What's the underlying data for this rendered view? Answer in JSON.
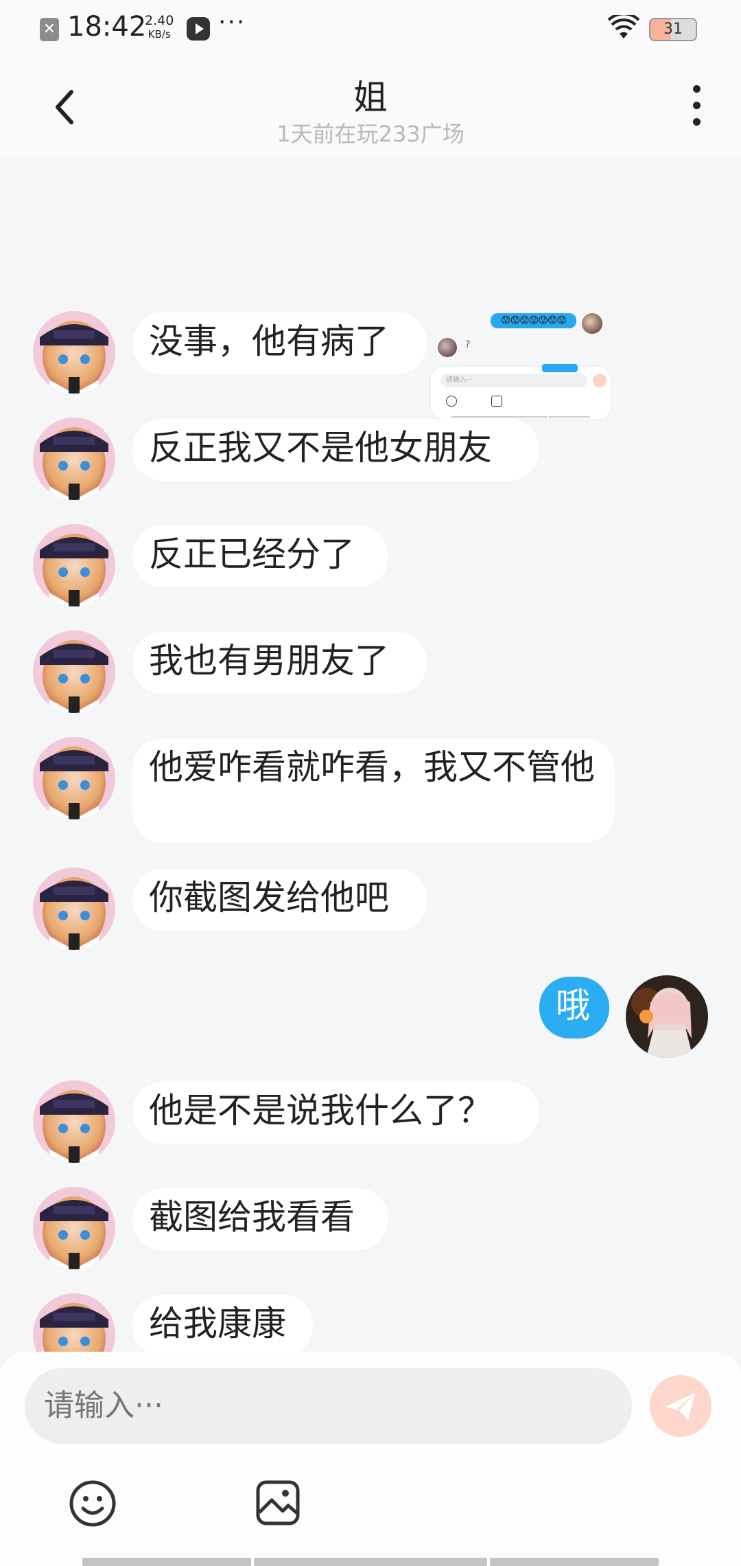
{
  "status_bar": {
    "time": "18:42",
    "speed_value": "2.40",
    "speed_unit": "KB/s",
    "more": "···",
    "battery": "31"
  },
  "header": {
    "title": "姐",
    "subtitle": "1天前在玩233广场"
  },
  "preview": {
    "emoji_text": "😟😟😟😟😟😟😟",
    "question": "?",
    "input_placeholder": "请输入···"
  },
  "messages": [
    {
      "side": "left",
      "text": "没事，他有病了"
    },
    {
      "side": "left",
      "text": "反正我又不是他女朋友"
    },
    {
      "side": "left",
      "text": "反正已经分了"
    },
    {
      "side": "left",
      "text": "我也有男朋友了"
    },
    {
      "side": "left",
      "text": "他爱咋看就咋看，我又不管他"
    },
    {
      "side": "left",
      "text": "你截图发给他吧"
    },
    {
      "side": "right",
      "text": "哦"
    },
    {
      "side": "left",
      "text": "他是不是说我什么了？"
    },
    {
      "side": "left",
      "text": "截图给我看看"
    },
    {
      "side": "left",
      "text": "给我康康"
    }
  ],
  "input": {
    "placeholder": "请输入···"
  },
  "colors": {
    "background": "#f5f6f8",
    "my_bubble": "#2aadf3",
    "their_bubble": "#ffffff",
    "send_button": "#fdd6cc"
  },
  "icons": [
    "back-icon",
    "more-icon",
    "emoji-icon",
    "image-icon",
    "send-icon"
  ]
}
